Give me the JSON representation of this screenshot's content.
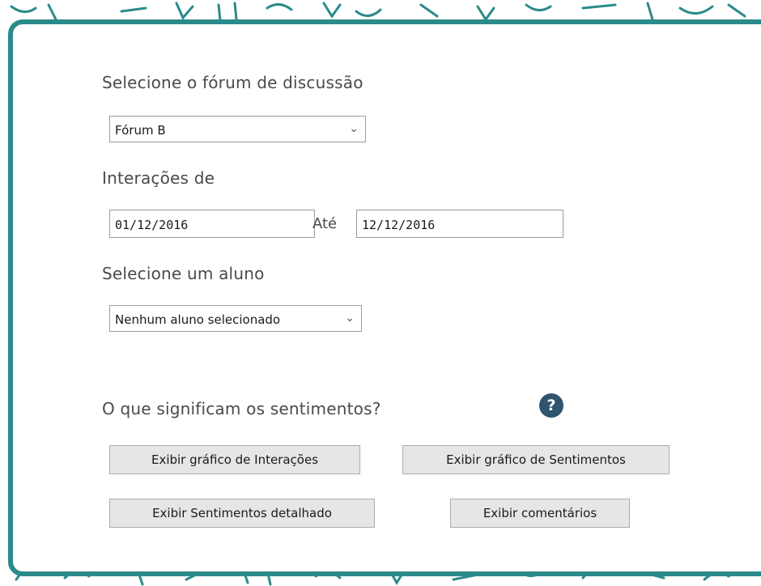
{
  "forum_section": {
    "label": "Selecione o fórum de discussão",
    "selected": "Fórum B"
  },
  "interactions_section": {
    "label": "Interações de",
    "from_date": "01/12/2016",
    "until_label": "Até",
    "to_date": "12/12/2016"
  },
  "student_section": {
    "label": "Selecione um aluno",
    "selected": "Nenhum aluno selecionado"
  },
  "sentiments_help": {
    "label": "O que significam os sentimentos?",
    "icon": "help-question-icon",
    "icon_glyph": "?"
  },
  "buttons": {
    "interactions_chart": "Exibir gráfico de Interações",
    "sentiments_chart": "Exibir gráfico de Sentimentos",
    "sentiments_detailed": "Exibir Sentimentos detalhado",
    "comments": "Exibir comentários"
  },
  "colors": {
    "panel_border": "#2b8a8a",
    "help_icon": "#2f5470",
    "button_bg": "#e6e6e6"
  }
}
